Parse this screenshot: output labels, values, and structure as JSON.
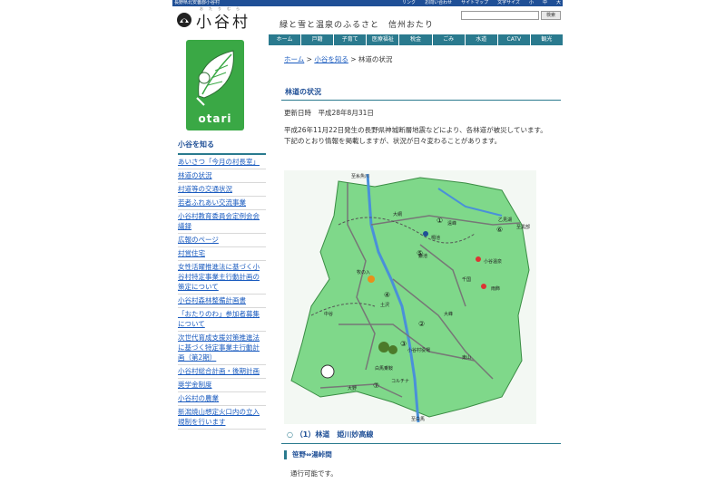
{
  "header": {
    "prefecture": "長野県北安曇郡小谷村",
    "links": [
      "リンク",
      "お問い合わせ",
      "サイトマップ",
      "文字サイズ",
      "小",
      "中",
      "大"
    ],
    "logo_text": "小谷村",
    "logo_ruby": "おたりむら",
    "tagline": "緑と雪と温泉のふるさと　信州おたり",
    "search_placeholder": "",
    "search_button": "検索"
  },
  "nav": {
    "items": [
      "ホーム",
      "戸籍",
      "子育て",
      "医療福祉",
      "税金",
      "ごみ",
      "水道",
      "CATV",
      "観光"
    ]
  },
  "sidebar": {
    "logo_name": "otari",
    "title": "小谷を知る",
    "items": [
      "あいさつ「今月の村長室」",
      "林道の状況",
      "村道等の交通状況",
      "若者ふれあい交流事業",
      "小谷村教育委員会定例会会議録",
      "広報のページ",
      "村営住宅",
      "女性活躍推進法に基づく小谷村特定事業主行動計画の策定について",
      "小谷村森林整備計画書",
      "「おたりのわ」参加者募集について",
      "次世代育成支援対策推進法に基づく特定事業主行動計画（第2期）",
      "小谷村総合計画・後期計画",
      "奨学金制度",
      "小谷村の農業",
      "新潟焼山想定火口内の立入規制を行います"
    ]
  },
  "main": {
    "breadcrumb": {
      "home": "ホーム",
      "sep1": " > ",
      "parent": "小谷を知る",
      "sep2": " > ",
      "current": "林道の状況"
    },
    "title": "林道の状況",
    "updated_label": "更新日時　平成28年8月31日",
    "intro": "平成26年11月22日発生の長野県神城断層地震などにより、各林道が被災しています。下記のとおり情報を掲載しますが、状況が日々変わることがあります。",
    "map": {
      "labels": [
        "至糸魚川",
        "大網",
        "遠峰",
        "乙見湖",
        "栂池",
        "至黒部",
        "鎌池",
        "小谷温泉",
        "雨飾",
        "千国",
        "牧の入",
        "土沢",
        "中谷",
        "大峰",
        "小谷村役場",
        "白馬乗鞍",
        "コルチナ",
        "大野",
        "東山",
        "至白馬"
      ],
      "numbers": [
        "①",
        "②",
        "③",
        "④",
        "⑤",
        "⑥",
        "⑦"
      ]
    },
    "section_heading": "（1）林道　姫川妙高線",
    "section_bullet": "○",
    "sub_heading": "笹野⇔湯峠間",
    "status": "通行可能です。"
  }
}
